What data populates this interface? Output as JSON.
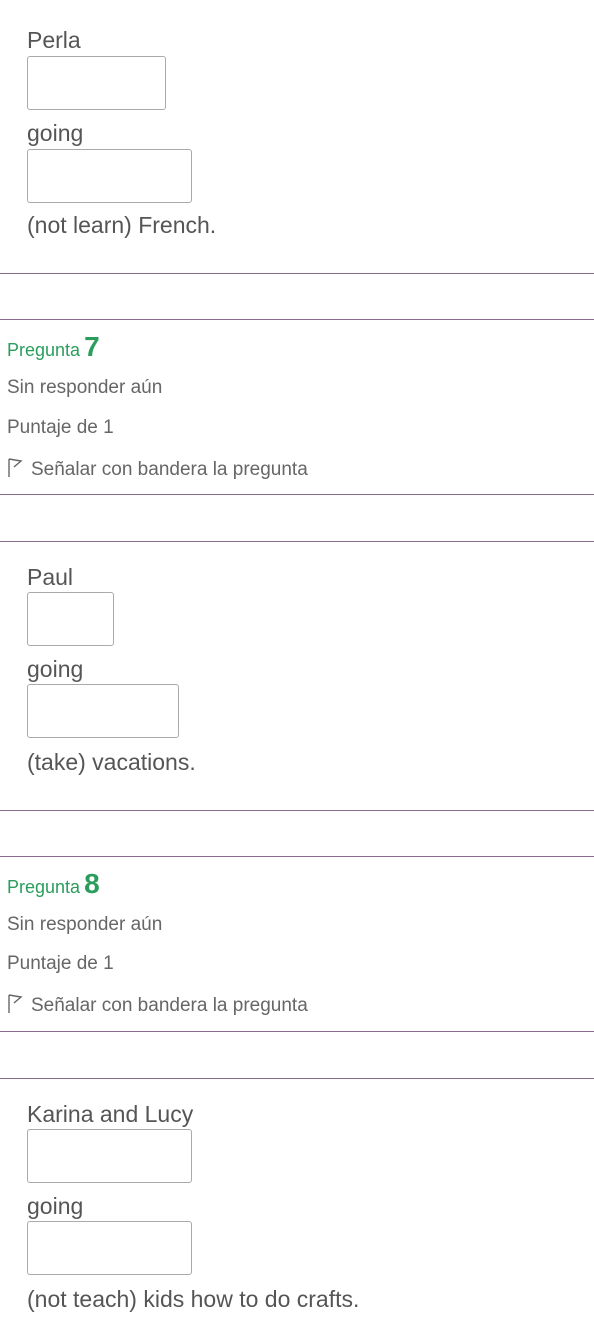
{
  "q6": {
    "subject": "Perla",
    "going": "going",
    "tail": "(not learn) French."
  },
  "q7": {
    "label": "Pregunta",
    "number": "7",
    "status": "Sin responder aún",
    "score": "Puntaje de 1",
    "flag": "Señalar con bandera la pregunta",
    "subject": "Paul",
    "going": "going",
    "tail": "(take) vacations."
  },
  "q8": {
    "label": "Pregunta",
    "number": "8",
    "status": "Sin responder aún",
    "score": "Puntaje de 1",
    "flag": "Señalar con bandera la pregunta",
    "subject": "Karina and Lucy",
    "going": "going",
    "tail": "(not teach) kids how to do crafts."
  },
  "colors": {
    "accent": "#2a9d5c",
    "rule": "#8a6a8e",
    "text": "#555555"
  },
  "icons": {
    "flag": "flag-icon"
  }
}
